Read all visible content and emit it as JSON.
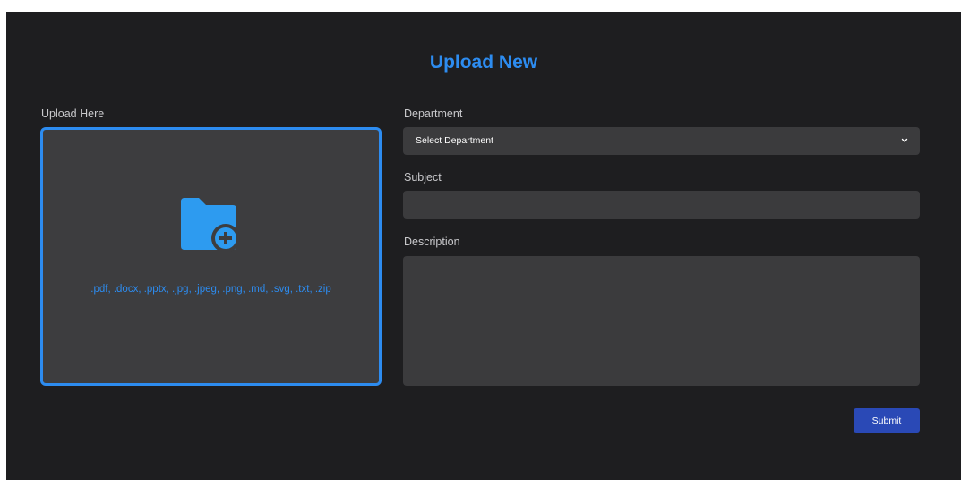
{
  "page": {
    "title": "Upload New"
  },
  "upload": {
    "label": "Upload Here",
    "icon": "folder-plus-icon",
    "accepted_types": ".pdf, .docx, .pptx, .jpg, .jpeg, .png, .md, .svg, .txt, .zip"
  },
  "department": {
    "label": "Department",
    "selected": "Select Department"
  },
  "subject": {
    "label": "Subject",
    "value": ""
  },
  "description": {
    "label": "Description",
    "value": ""
  },
  "actions": {
    "submit_label": "Submit"
  },
  "colors": {
    "accent": "#2d8cf0",
    "background": "#1e1e20",
    "field": "#3b3b3d",
    "button": "#2a49b6"
  }
}
